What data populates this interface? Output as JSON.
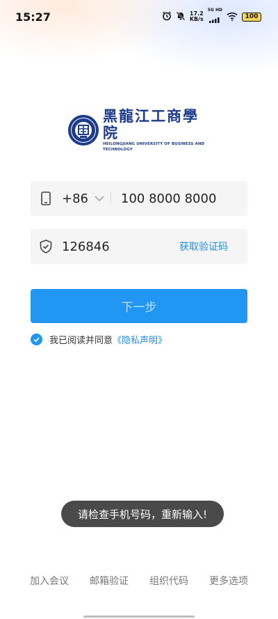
{
  "status_bar": {
    "time": "15:27",
    "speed_value": "17.2",
    "speed_unit": "KB/s",
    "network": "5G HD",
    "battery": "100",
    "icons": [
      "alarm-icon",
      "mute-icon",
      "signal-icon",
      "wifi-icon",
      "battery-icon"
    ]
  },
  "logo": {
    "cn_name": "黑龍江工商學院",
    "en_name": "HEILONGJIANG UNIVERSITY OF BUSINESS AND TECHNOLOGY"
  },
  "phone_field": {
    "country_code": "+86",
    "value": "100 8000 8000",
    "icon": "phone-icon"
  },
  "code_field": {
    "value": "126846",
    "icon": "shield-check-icon",
    "get_code_label": "获取验证码"
  },
  "next_button": {
    "label": "下一步"
  },
  "agreement": {
    "checked": true,
    "text": "我已阅读并同意",
    "link": "《隐私声明》"
  },
  "toast": {
    "message": "请检查手机号码，重新输入!"
  },
  "bottom_options": [
    "加入会议",
    "邮箱验证",
    "组织代码",
    "更多选项"
  ],
  "colors": {
    "accent": "#2196f3",
    "link": "#1f8ef1",
    "brand": "#1d3b8a"
  }
}
